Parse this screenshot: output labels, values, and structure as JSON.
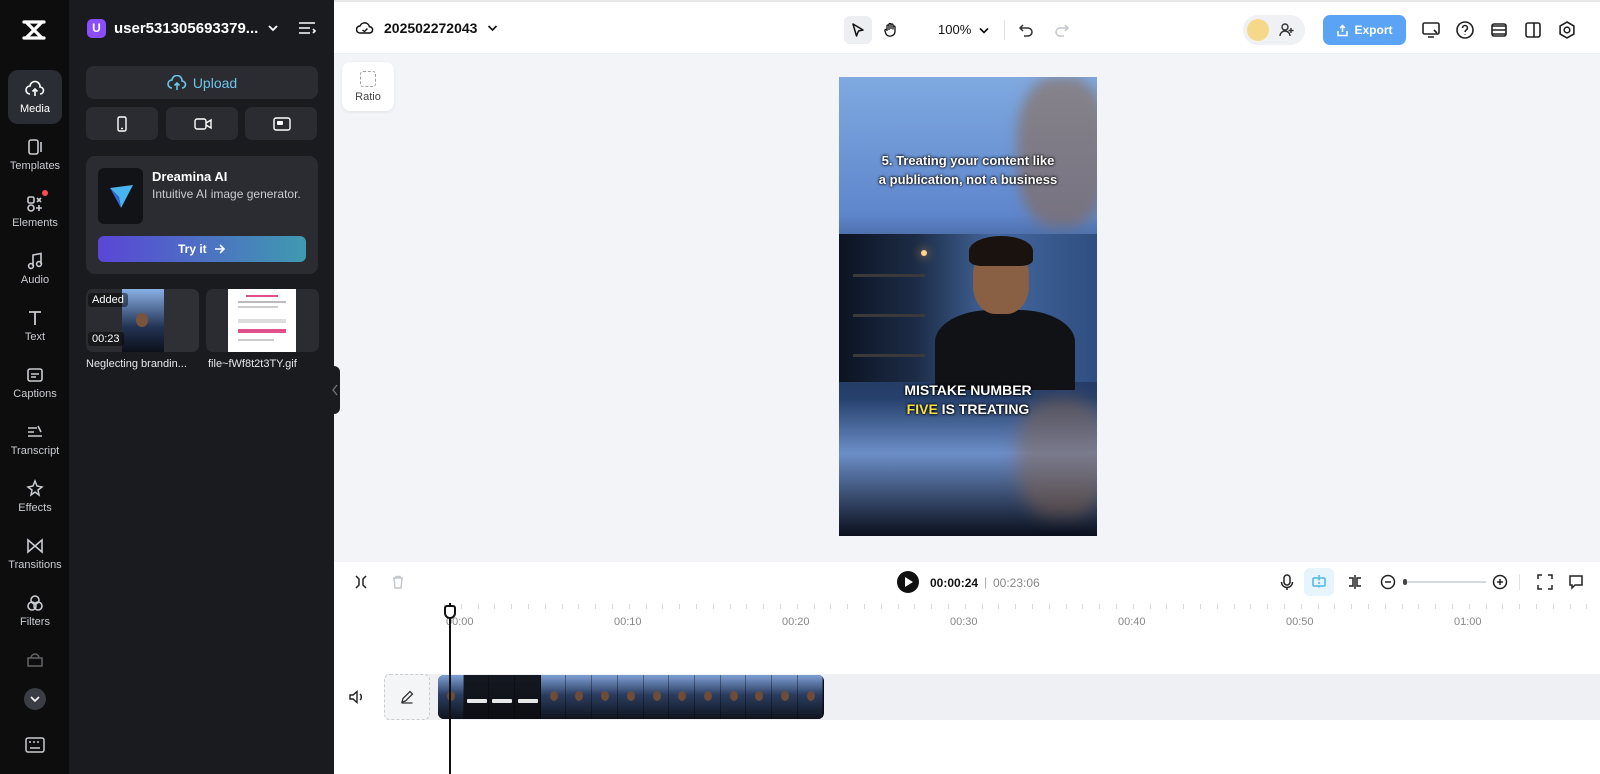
{
  "rail": {
    "items": [
      {
        "label": "Media",
        "icon": "cloud-upload-icon",
        "active": true
      },
      {
        "label": "Templates",
        "icon": "templates-icon"
      },
      {
        "label": "Elements",
        "icon": "elements-icon",
        "badge": true
      },
      {
        "label": "Audio",
        "icon": "music-note-icon"
      },
      {
        "label": "Text",
        "icon": "text-icon"
      },
      {
        "label": "Captions",
        "icon": "captions-icon"
      },
      {
        "label": "Transcript",
        "icon": "transcript-icon"
      },
      {
        "label": "Effects",
        "icon": "effects-icon"
      },
      {
        "label": "Transitions",
        "icon": "transitions-icon"
      },
      {
        "label": "Filters",
        "icon": "filters-icon"
      }
    ]
  },
  "panel": {
    "account_initial": "U",
    "account_name": "user531305693379...",
    "upload_label": "Upload",
    "promo": {
      "title": "Dreamina AI",
      "description": "Intuitive AI image generator.",
      "button": "Try it"
    },
    "assets": [
      {
        "name": "Neglecting brandin...",
        "tag": "Added",
        "duration": "00:23"
      },
      {
        "name": "file~fWf8t2t3TY.gif"
      }
    ]
  },
  "topbar": {
    "project_name": "202502272043",
    "zoom": "100%",
    "export_label": "Export"
  },
  "canvas": {
    "ratio_label": "Ratio",
    "caption_top_line1": "5. Treating your content like",
    "caption_top_line2": "a publication, not a business",
    "caption_main_line1": "MISTAKE NUMBER",
    "caption_main_highlight": "FIVE",
    "caption_main_rest": " IS TREATING"
  },
  "timeline": {
    "current_time": "00:00:24",
    "separator": "|",
    "total_time": "00:23:06",
    "ruler": [
      "00:00",
      "00:10",
      "00:20",
      "00:30",
      "00:40",
      "00:50",
      "01:00"
    ]
  },
  "colors": {
    "accent": "#5ba4f5",
    "upload_text": "#6cc6e8",
    "highlight": "#f5e04a"
  }
}
